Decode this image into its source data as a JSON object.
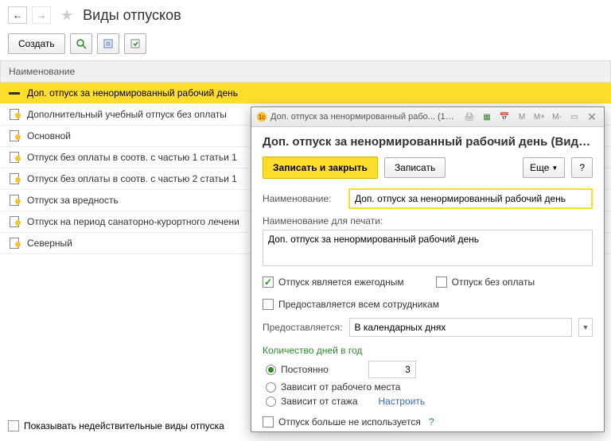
{
  "header": {
    "title": "Виды отпусков"
  },
  "toolbar": {
    "create": "Создать"
  },
  "table": {
    "header": "Наименование",
    "rows": [
      "Доп. отпуск за ненормированный рабочий день",
      "Дополнительный учебный отпуск без оплаты",
      "Основной",
      "Отпуск без оплаты в соотв. с частью 1 статьи 1",
      "Отпуск без оплаты в соотв. с частью 2 статьи 1",
      "Отпуск за вредность",
      "Отпуск на период санаторно-курортного лечени",
      "Северный"
    ]
  },
  "footer": {
    "label": "Показывать недействительные виды отпуска"
  },
  "dialog": {
    "tb_title": "Доп. отпуск за ненормированный рабо... (1С:Предприятие)",
    "title": "Доп. отпуск за ненормированный рабочий день (Вид отп...",
    "save_close": "Записать и закрыть",
    "save": "Записать",
    "more": "Еще",
    "name_label": "Наименование:",
    "name_value": "Доп. отпуск за ненормированный рабочий день",
    "print_label": "Наименование для печати:",
    "print_value": "Доп. отпуск за ненормированный рабочий день",
    "annual": "Отпуск является ежегодным",
    "unpaid": "Отпуск без оплаты",
    "all_emp": "Предоставляется всем сотрудникам",
    "granted_label": "Предоставляется:",
    "granted_value": "В календарных днях",
    "days_label": "Количество дней в год",
    "r_const": "Постоянно",
    "r_const_val": "3",
    "r_workplace": "Зависит от рабочего места",
    "r_seniority": "Зависит от стажа",
    "configure": "Настроить",
    "not_used": "Отпуск больше не используется"
  }
}
